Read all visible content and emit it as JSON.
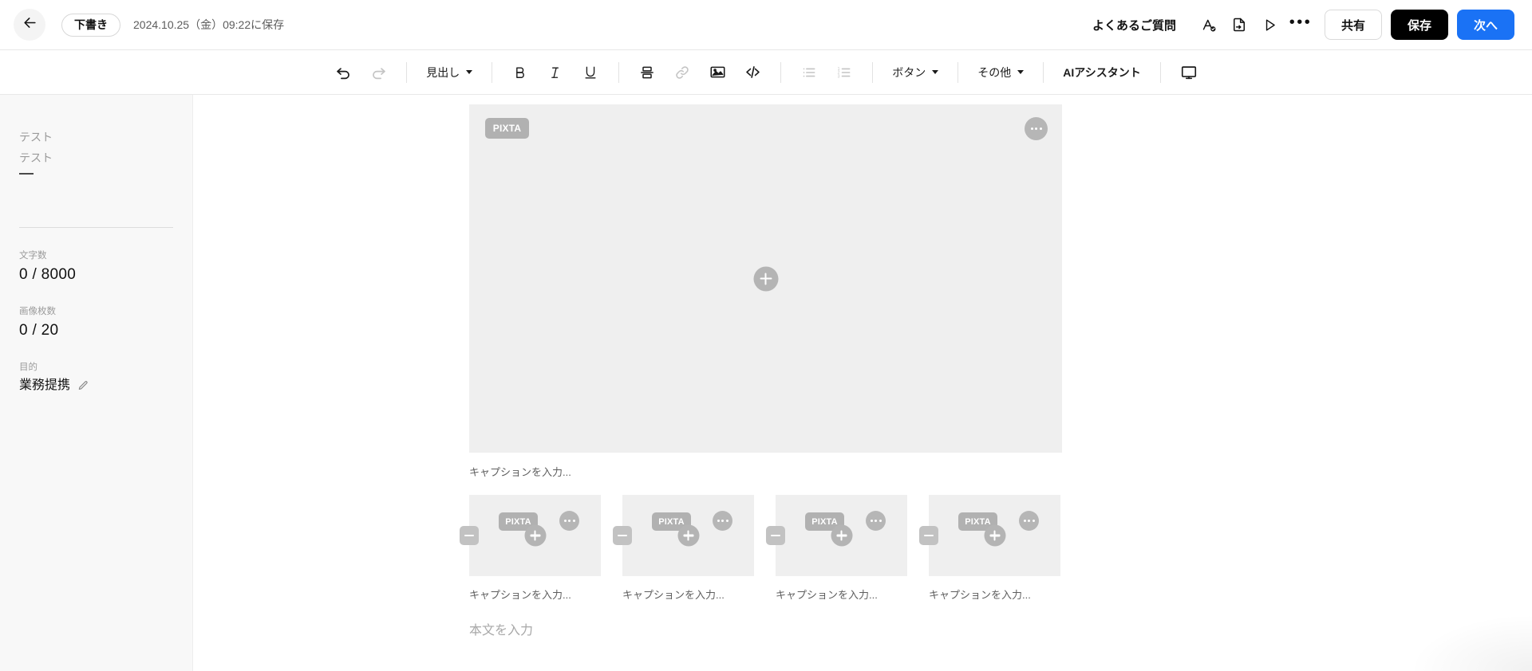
{
  "header": {
    "back_icon": "arrow-left-icon",
    "status_label": "下書き",
    "saved_text": "2024.10.25（金）09:22に保存",
    "faq_label": "よくあるご質問",
    "proofread_icon": "spellcheck-icon",
    "export_icon": "file-export-icon",
    "preview_icon": "play-triangle-icon",
    "more_icon": "ellipsis-icon",
    "more_label": "•••",
    "share_label": "共有",
    "save_label": "保存",
    "next_label": "次へ",
    "accent_color": "#1a72f5",
    "save_bg_color": "#000000"
  },
  "toolbar": {
    "undo_icon": "undo-icon",
    "redo_icon": "redo-icon",
    "heading_label": "見出し",
    "bold_label": "B",
    "italic_label": "I",
    "underline_label": "U",
    "divider_icon": "horizontal-divider-icon",
    "link_icon": "link-icon",
    "image_icon": "image-icon",
    "code_icon": "code-icon",
    "bullet_list_icon": "bullet-list-icon",
    "numbered_list_icon": "numbered-list-icon",
    "button_label": "ボタン",
    "other_label": "その他",
    "ai_assistant_label": "AIアシスタント",
    "preview_monitor_icon": "monitor-icon"
  },
  "sidebar": {
    "outline_items": [
      {
        "label": "テスト"
      },
      {
        "label": "テスト"
      }
    ],
    "stats": [
      {
        "label": "文字数",
        "value": "0 / 8000"
      },
      {
        "label": "画像枚数",
        "value": "0 / 20"
      }
    ],
    "purpose": {
      "label": "目的",
      "value": "業務提携",
      "edit_icon": "pencil-icon"
    }
  },
  "editor": {
    "hero": {
      "badge_label": "PIXTA",
      "more_icon": "ellipsis-icon",
      "add_icon": "plus-icon",
      "caption_placeholder": "キャプションを入力..."
    },
    "thumbnails": [
      {
        "badge_label": "PIXTA",
        "caption_placeholder": "キャプションを入力...",
        "remove_icon": "minus-icon",
        "add_icon": "plus-icon",
        "more_icon": "ellipsis-icon"
      },
      {
        "badge_label": "PIXTA",
        "caption_placeholder": "キャプションを入力...",
        "remove_icon": "minus-icon",
        "add_icon": "plus-icon",
        "more_icon": "ellipsis-icon"
      },
      {
        "badge_label": "PIXTA",
        "caption_placeholder": "キャプションを入力...",
        "remove_icon": "minus-icon",
        "add_icon": "plus-icon",
        "more_icon": "ellipsis-icon"
      },
      {
        "badge_label": "PIXTA",
        "caption_placeholder": "キャプションを入力...",
        "remove_icon": "minus-icon",
        "add_icon": "plus-icon",
        "more_icon": "ellipsis-icon"
      }
    ],
    "body_placeholder": "本文を入力"
  }
}
